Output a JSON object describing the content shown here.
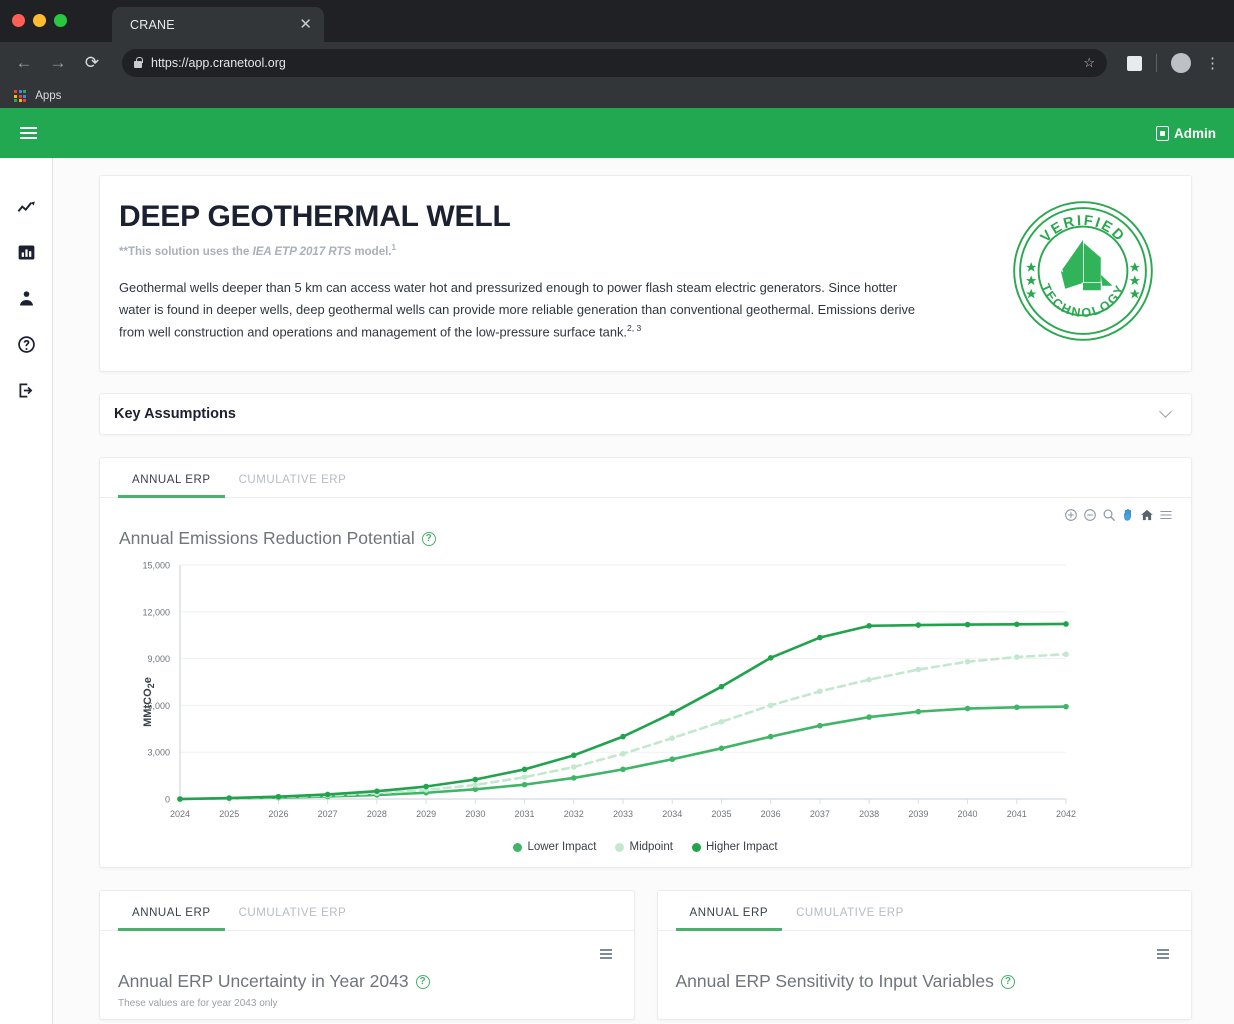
{
  "browser": {
    "tab_title": "CRANE",
    "close_label": "✕",
    "back_icon": "←",
    "forward_icon": "→",
    "reload_icon": "⟳",
    "url": "https://app.cranetool.org",
    "star_icon": "☆",
    "kebab_icon": "⋮",
    "apps_label": "Apps"
  },
  "appbar": {
    "menu_icon": "hamburger-icon",
    "admin_label": "Admin"
  },
  "sidebar": {
    "items": [
      {
        "name": "trend-chart",
        "label": "Trends"
      },
      {
        "name": "bar-chart",
        "label": "Reports"
      },
      {
        "name": "person",
        "label": "Account"
      },
      {
        "name": "help",
        "label": "Help"
      },
      {
        "name": "login",
        "label": "Sign in"
      }
    ]
  },
  "hero": {
    "title": "DEEP GEOTHERMAL WELL",
    "model_prefix": "**This solution uses the",
    "model_name": "IEA ETP 2017 RTS",
    "model_suffix": "model.",
    "model_ref": "1",
    "description": "Geothermal wells deeper than 5 km can access water hot and pressurized enough to power flash steam electric generators. Since hotter water is found in deeper wells, deep geothermal wells can provide more reliable generation than conventional geothermal. Emissions derive from well construction and operations and management of the low-pressure surface tank.",
    "description_ref": "2, 3",
    "badge_top_text": "VERIFIED",
    "badge_bottom_text": "TECHNOLOGY"
  },
  "assumptions": {
    "title": "Key Assumptions",
    "chevron": "chevron-down-icon"
  },
  "main_panel": {
    "tabs": [
      {
        "label": "ANNUAL ERP",
        "active": true
      },
      {
        "label": "CUMULATIVE ERP",
        "active": false
      }
    ],
    "toolbar": [
      "zoom-in-icon",
      "zoom-out-icon",
      "selection-zoom-icon",
      "pan-icon",
      "home-icon",
      "menu-icon"
    ],
    "title": "Annual Emissions Reduction Potential",
    "help_icon": "?"
  },
  "bottom_panels": [
    {
      "tabs": [
        {
          "label": "ANNUAL ERP",
          "active": true
        },
        {
          "label": "CUMULATIVE ERP",
          "active": false
        }
      ],
      "title": "Annual ERP Uncertainty in Year 2043",
      "subtitle": "These values are for year 2043 only",
      "help_icon": "?"
    },
    {
      "tabs": [
        {
          "label": "ANNUAL ERP",
          "active": true
        },
        {
          "label": "CUMULATIVE ERP",
          "active": false
        }
      ],
      "title": "Annual ERP Sensitivity to Input Variables",
      "subtitle": "",
      "help_icon": "?"
    }
  ],
  "colors": {
    "brand_green": "#22a850",
    "lower_impact": "#3fb567",
    "midpoint": "#c3e8cf",
    "higher_impact": "#21a24c",
    "tab_underline": "#4caf6d"
  },
  "chart_data": {
    "type": "line",
    "title": "Annual Emissions Reduction Potential",
    "xlabel": "",
    "ylabel": "MMtCO₂e",
    "ylim": [
      0,
      15000
    ],
    "yticks": [
      0,
      3000,
      6000,
      9000,
      12000,
      15000
    ],
    "ytick_labels": [
      "0",
      "3,000",
      "6,000",
      "9,000",
      "12,000",
      "15,000"
    ],
    "grid": true,
    "legend_position": "bottom",
    "x": [
      2024,
      2025,
      2026,
      2027,
      2028,
      2029,
      2030,
      2031,
      2032,
      2033,
      2034,
      2035,
      2036,
      2037,
      2038,
      2039,
      2040,
      2041,
      2042
    ],
    "series": [
      {
        "name": "Lower Impact",
        "color": "#3fb567",
        "style": "solid",
        "values": [
          0,
          40,
          90,
          160,
          260,
          400,
          620,
          920,
          1350,
          1900,
          2550,
          3250,
          4000,
          4700,
          5250,
          5600,
          5800,
          5880,
          5920
        ]
      },
      {
        "name": "Midpoint",
        "color": "#c3e8cf",
        "style": "dashed",
        "values": [
          0,
          50,
          120,
          220,
          370,
          580,
          900,
          1400,
          2050,
          2900,
          3900,
          4950,
          6000,
          6900,
          7650,
          8300,
          8800,
          9100,
          9280
        ]
      },
      {
        "name": "Higher Impact",
        "color": "#21a24c",
        "style": "solid",
        "values": [
          0,
          60,
          150,
          290,
          500,
          800,
          1250,
          1900,
          2800,
          4000,
          5500,
          7200,
          9050,
          10350,
          11100,
          11150,
          11180,
          11200,
          11220
        ]
      }
    ]
  }
}
